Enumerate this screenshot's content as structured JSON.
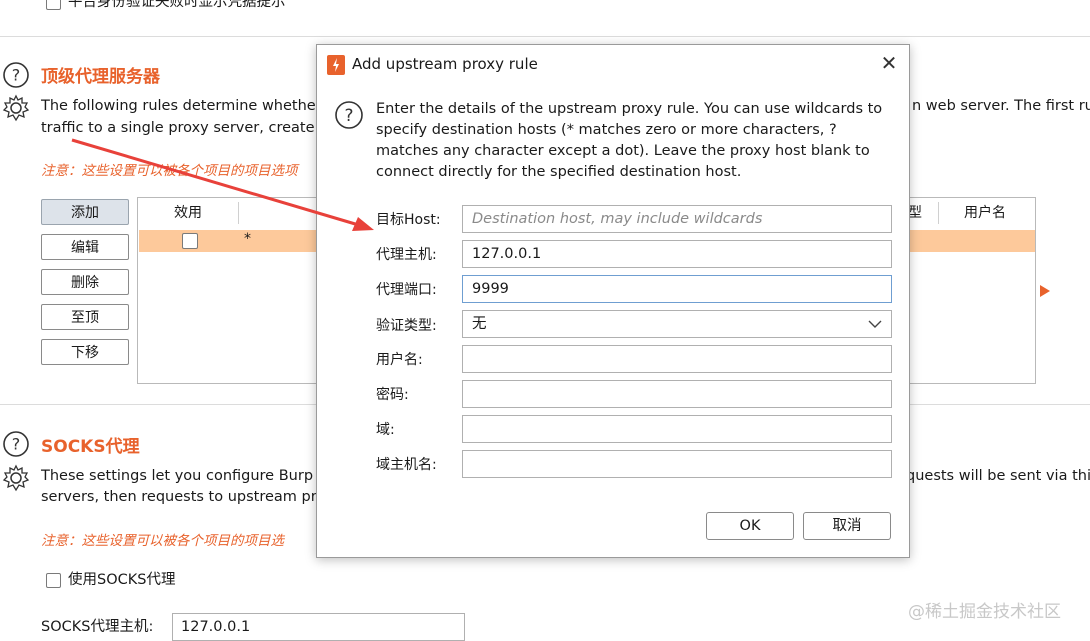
{
  "top_option": {
    "label": "平台身份验证失败时显示凭据提示"
  },
  "upstream_section": {
    "title": "顶级代理服务器",
    "desc_line1": "The following rules determine whethe",
    "desc_line1_right": "n web server. The first ru",
    "desc_line2": "traffic to a single proxy server, create a",
    "note": "注意：这些设置可以被各个项目的项目选项",
    "buttons": [
      "添加",
      "编辑",
      "删除",
      "至顶",
      "下移"
    ],
    "table": {
      "headers": [
        "效用",
        "型",
        "用户名"
      ],
      "rows": [
        {
          "enabled": false,
          "dest": "*"
        }
      ]
    }
  },
  "socks_section": {
    "title": "SOCKS代理",
    "desc_line1": "These settings let you configure Burp",
    "desc_line1_right": "quests will be sent via this",
    "desc_line2": "servers, then requests to upstream pro",
    "note": "注意：这些设置可以被各个项目的项目选",
    "use_socks_label": "使用SOCKS代理",
    "host_label": "SOCKS代理主机:",
    "host_value": "127.0.0.1"
  },
  "dialog": {
    "title": "Add upstream proxy rule",
    "close": "✕",
    "desc_lines": [
      "Enter the details of the upstream proxy rule. You can use wildcards to",
      "specify destination hosts (* matches zero or more characters, ?",
      "matches any character except a dot). Leave the proxy host blank to",
      "connect directly for the specified destination host."
    ],
    "fields": {
      "dest_host_label": "目标Host:",
      "dest_host_placeholder": "Destination host, may include wildcards",
      "proxy_host_label": "代理主机:",
      "proxy_host_value": "127.0.0.1",
      "proxy_port_label": "代理端口:",
      "proxy_port_value": "9999",
      "auth_type_label": "验证类型:",
      "auth_type_value": "无",
      "username_label": "用户名:",
      "password_label": "密码:",
      "domain_label": "域:",
      "domain_host_label": "域主机名:"
    },
    "ok": "OK",
    "cancel": "取消"
  },
  "watermark": "@稀土掘金技术社区",
  "colors": {
    "accent": "#e8622c",
    "selection": "#fdc99b",
    "arrow": "#e8413a"
  }
}
